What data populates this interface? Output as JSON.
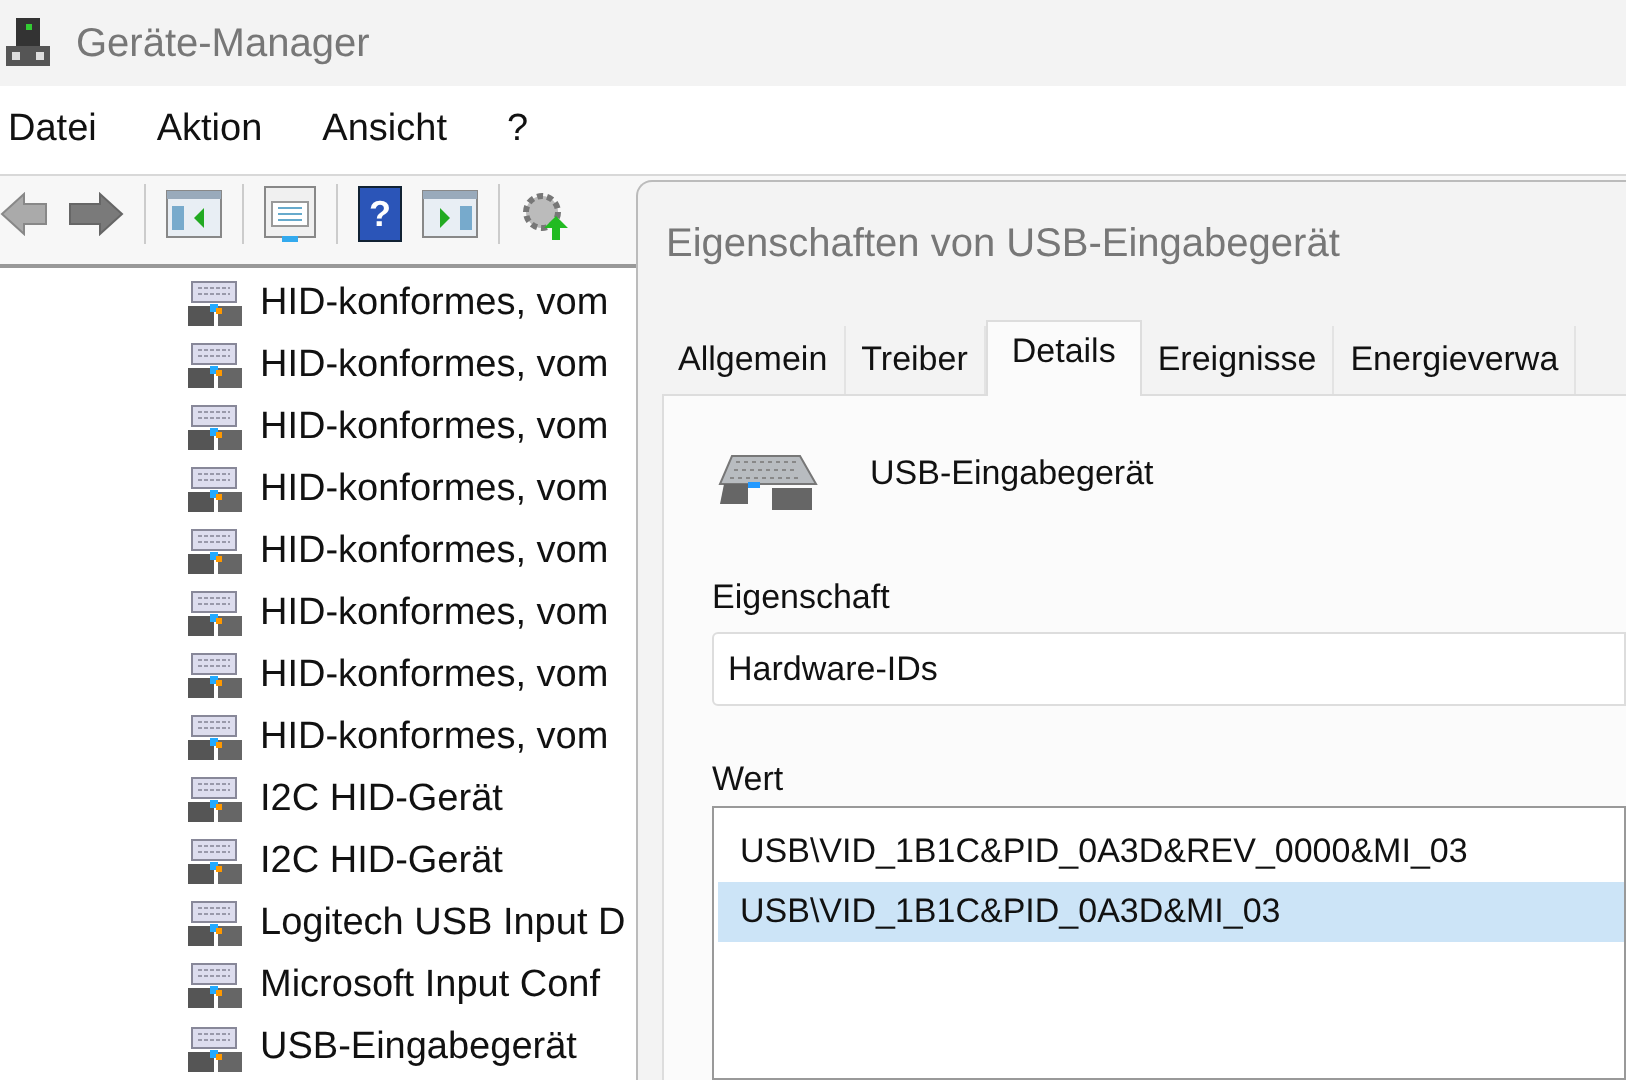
{
  "window": {
    "title": "Geräte-Manager"
  },
  "menu": [
    "Datei",
    "Aktion",
    "Ansicht",
    "?"
  ],
  "toolbar": [
    {
      "kind": "back",
      "disabled": true
    },
    {
      "kind": "forward",
      "disabled": false
    },
    {
      "kind": "sep"
    },
    {
      "kind": "panel-left"
    },
    {
      "kind": "sep"
    },
    {
      "kind": "properties"
    },
    {
      "kind": "sep"
    },
    {
      "kind": "help",
      "glyph": "?"
    },
    {
      "kind": "panel-right"
    },
    {
      "kind": "sep"
    },
    {
      "kind": "update"
    }
  ],
  "tree": [
    "HID-konformes, vom",
    "HID-konformes, vom",
    "HID-konformes, vom",
    "HID-konformes, vom",
    "HID-konformes, vom",
    "HID-konformes, vom",
    "HID-konformes, vom",
    "HID-konformes, vom",
    "I2C HID-Gerät",
    "I2C HID-Gerät",
    "Logitech USB Input D",
    "Microsoft Input Conf",
    "USB-Eingabegerät"
  ],
  "dialog": {
    "title": "Eigenschaften von USB-Eingabegerät",
    "tabs": [
      {
        "label": "Allgemein",
        "selected": false
      },
      {
        "label": "Treiber",
        "selected": false
      },
      {
        "label": "Details",
        "selected": true
      },
      {
        "label": "Ereignisse",
        "selected": false
      },
      {
        "label": "Energieverwa",
        "selected": false
      }
    ],
    "device_name": "USB-Eingabegerät",
    "property_label": "Eigenschaft",
    "property_value": "Hardware-IDs",
    "value_label": "Wert",
    "values": [
      {
        "text": "USB\\VID_1B1C&PID_0A3D&REV_0000&MI_03",
        "selected": false
      },
      {
        "text": "USB\\VID_1B1C&PID_0A3D&MI_03",
        "selected": true
      }
    ]
  }
}
